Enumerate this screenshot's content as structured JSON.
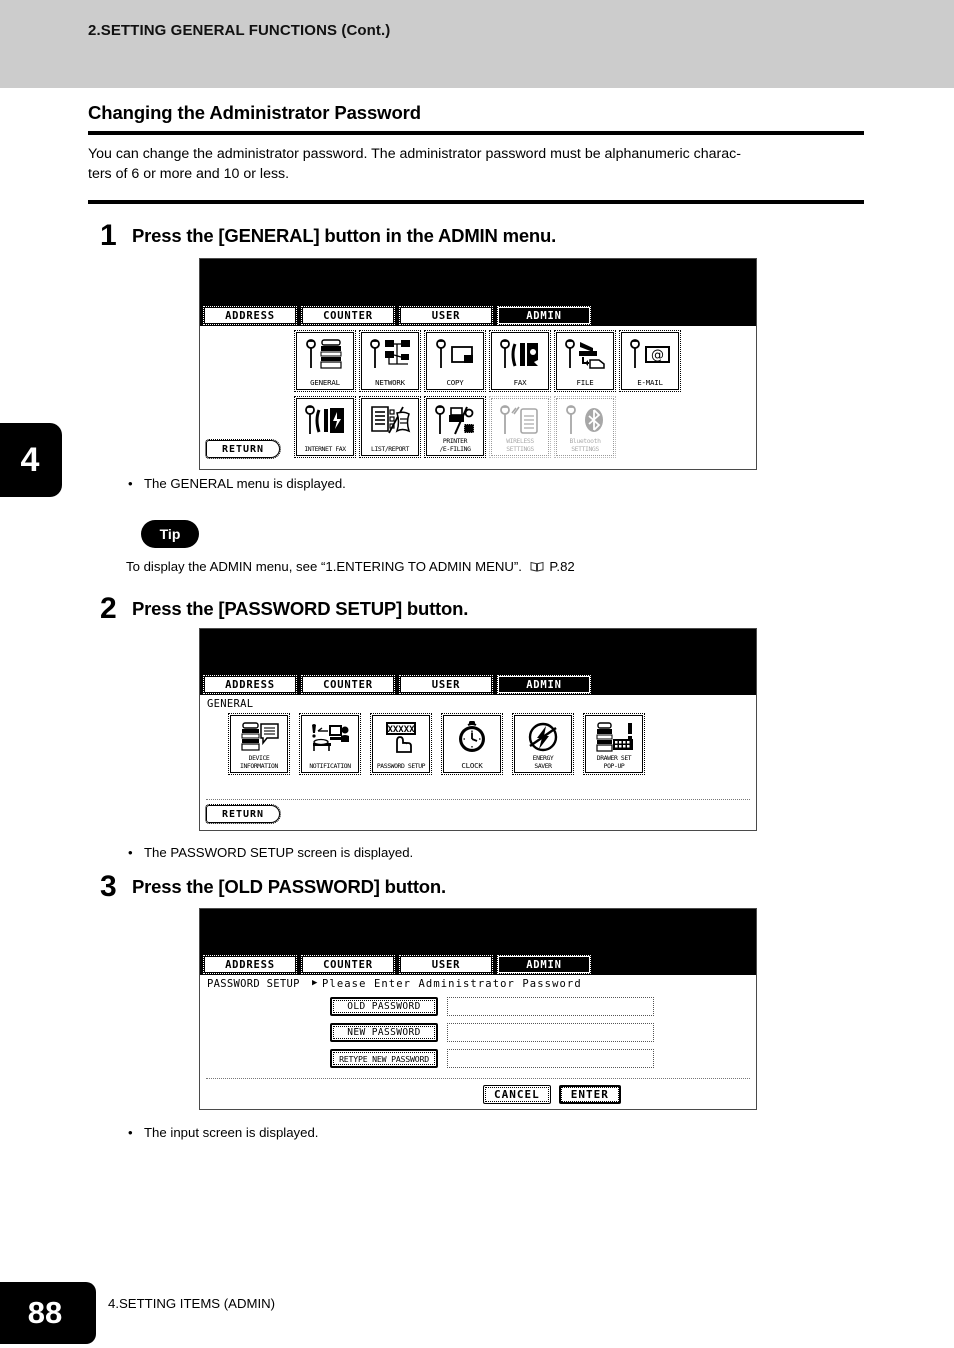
{
  "header": {
    "running_title": "2.SETTING GENERAL FUNCTIONS (Cont.)"
  },
  "chapter_tab": "4",
  "section": {
    "title": "Changing the Administrator Password",
    "intro_line1": "You can change the administrator password.  The administrator password must be alphanumeric charac-",
    "intro_line2": "ters of 6 or more and 10 or less."
  },
  "steps": [
    {
      "number": "1",
      "heading": "Press the [GENERAL] button in the ADMIN menu.",
      "note_bullet": "•",
      "note": "The GENERAL menu is displayed."
    },
    {
      "number": "2",
      "heading": "Press the [PASSWORD SETUP] button.",
      "note_bullet": "•",
      "note": "The PASSWORD SETUP screen is displayed."
    },
    {
      "number": "3",
      "heading": "Press the [OLD PASSWORD] button.",
      "note_bullet": "•",
      "note": "The input screen is displayed."
    }
  ],
  "tip": {
    "label": "Tip",
    "text_before": "To display the ADMIN menu, see “1.ENTERING TO ADMIN MENU”.",
    "page_ref": "P.82"
  },
  "screen1": {
    "tabs": [
      {
        "label": "ADDRESS",
        "selected": false
      },
      {
        "label": "COUNTER",
        "selected": false
      },
      {
        "label": "USER",
        "selected": false
      },
      {
        "label": "ADMIN",
        "selected": true
      }
    ],
    "row1": [
      {
        "label": "GENERAL",
        "icon": "wrench-printer-icon",
        "dim": false
      },
      {
        "label": "NETWORK",
        "icon": "wrench-network-icon",
        "dim": false
      },
      {
        "label": "COPY",
        "icon": "wrench-copy-icon",
        "dim": false
      },
      {
        "label": "FAX",
        "icon": "wrench-fax-icon",
        "dim": false
      },
      {
        "label": "FILE",
        "icon": "wrench-file-icon",
        "dim": false
      },
      {
        "label": "E-MAIL",
        "icon": "wrench-email-icon",
        "dim": false
      }
    ],
    "row2": [
      {
        "label": "INTERNET FAX",
        "icon": "wrench-internetfax-icon",
        "dim": false
      },
      {
        "label": "LIST/REPORT",
        "icon": "list-report-icon",
        "dim": false
      },
      {
        "label": "PRINTER\n/E-FILING",
        "icon": "wrench-printer-efile-icon",
        "dim": false
      },
      {
        "label": "WIRELESS\nSETTINGS",
        "icon": "wrench-wireless-icon",
        "dim": true
      },
      {
        "label": "Bluetooth\nSETTINGS",
        "icon": "wrench-bluetooth-icon",
        "dim": true
      }
    ],
    "return_label": "RETURN"
  },
  "screen2": {
    "tabs": [
      {
        "label": "ADDRESS",
        "selected": false
      },
      {
        "label": "COUNTER",
        "selected": false
      },
      {
        "label": "USER",
        "selected": false
      },
      {
        "label": "ADMIN",
        "selected": true
      }
    ],
    "breadcrumb": "GENERAL",
    "items": [
      {
        "label": "DEVICE\nINFORMATION",
        "icon": "device-information-icon"
      },
      {
        "label": "NOTIFICATION",
        "icon": "notification-icon"
      },
      {
        "label": "PASSWORD SETUP",
        "icon": "password-setup-icon"
      },
      {
        "label": "CLOCK",
        "icon": "clock-icon"
      },
      {
        "label": "ENERGY\nSAVER",
        "icon": "energy-saver-icon"
      },
      {
        "label": "DRAWER SET\nPOP-UP",
        "icon": "drawer-set-popup-icon"
      }
    ],
    "return_label": "RETURN"
  },
  "screen3": {
    "tabs": [
      {
        "label": "ADDRESS",
        "selected": false
      },
      {
        "label": "COUNTER",
        "selected": false
      },
      {
        "label": "USER",
        "selected": false
      },
      {
        "label": "ADMIN",
        "selected": true
      }
    ],
    "breadcrumb": "PASSWORD SETUP",
    "prompt_marker": "▶",
    "prompt": "Please Enter Administrator Password",
    "fields": [
      {
        "button": "OLD PASSWORD",
        "value": ""
      },
      {
        "button": "NEW PASSWORD",
        "value": ""
      },
      {
        "button": "RETYPE NEW PASSWORD",
        "value": ""
      }
    ],
    "cancel_label": "CANCEL",
    "enter_label": "ENTER"
  },
  "footer": {
    "page_number": "88",
    "text": "4.SETTING ITEMS (ADMIN)"
  },
  "colors": {
    "banner": "#cccccc",
    "ink": "#000000",
    "paper": "#ffffff"
  }
}
